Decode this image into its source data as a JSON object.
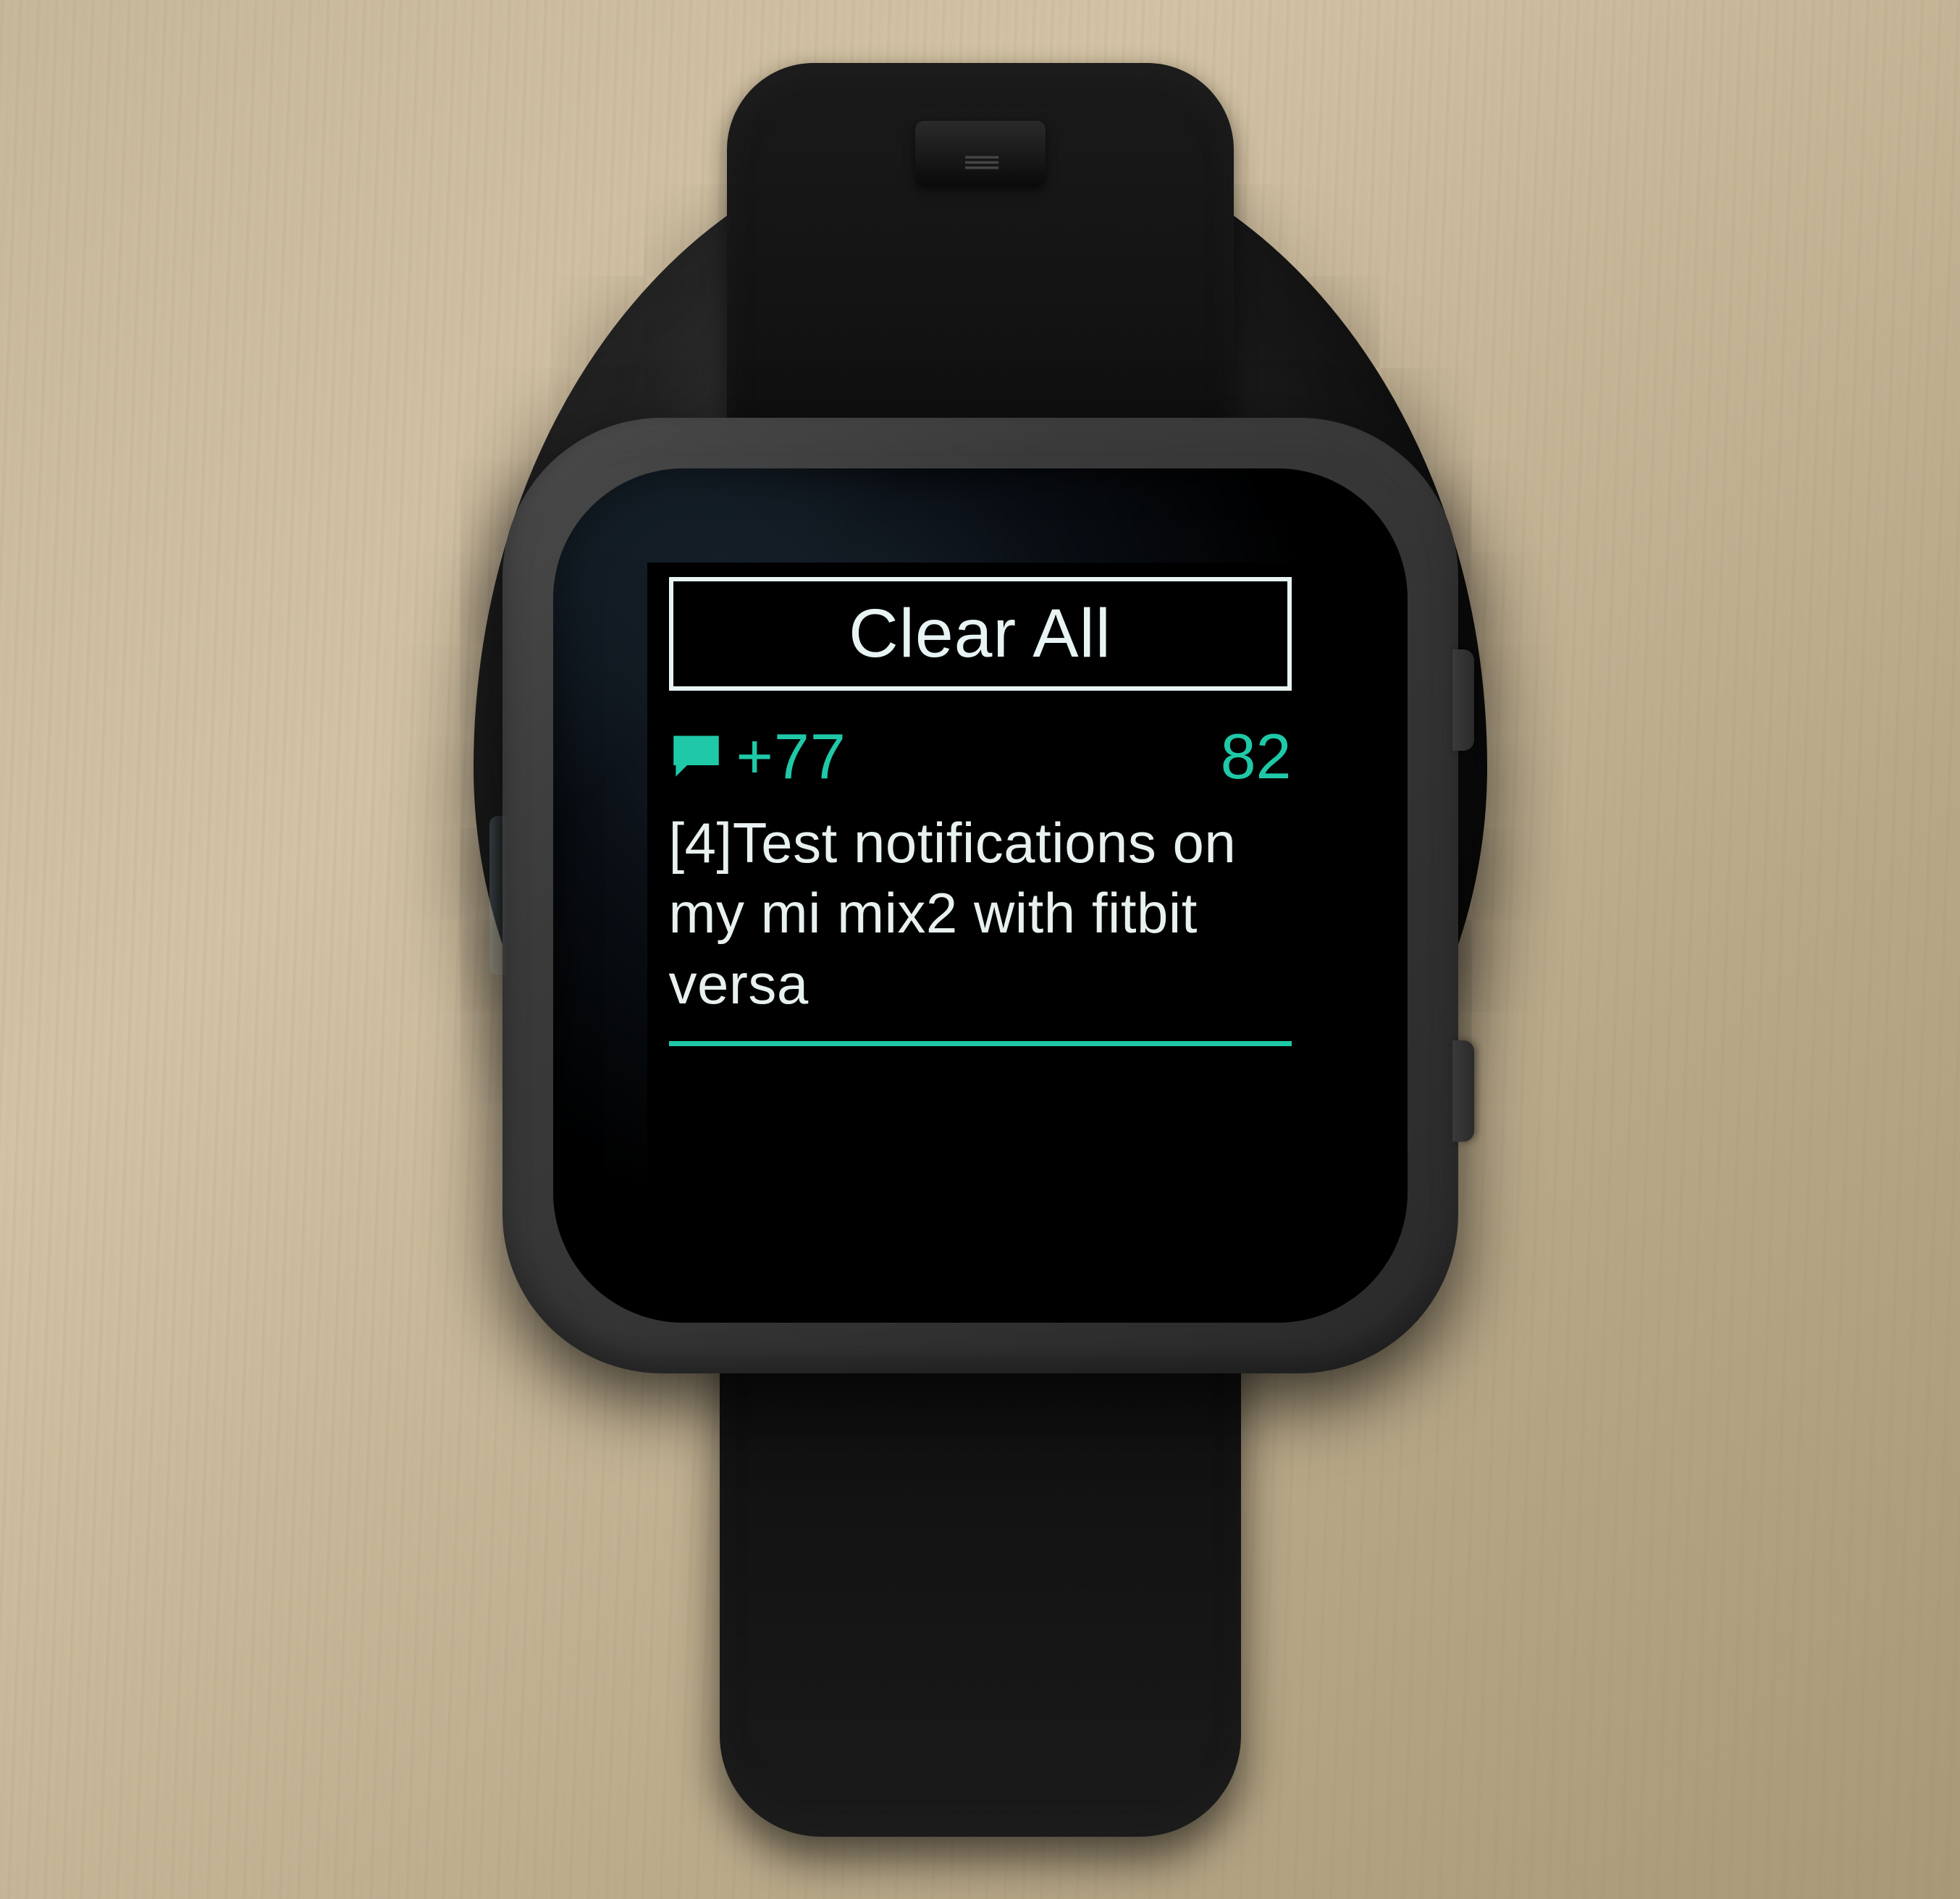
{
  "accent_color": "#1fc9a8",
  "text_color": "#e8f0f0",
  "clear_button": {
    "label": "Clear All"
  },
  "notification": {
    "icon": "chat-bubble-icon",
    "sender": "+77",
    "count": "82",
    "body": "[4]Test notifications on my  mi mix2 with fitbit versa"
  }
}
